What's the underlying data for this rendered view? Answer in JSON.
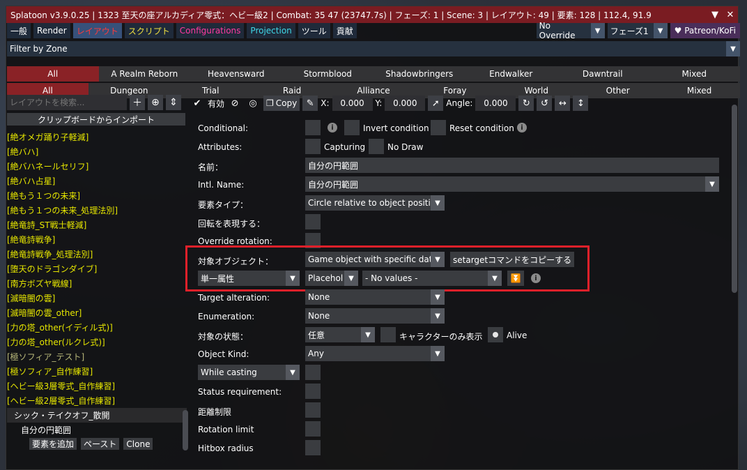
{
  "window": {
    "title": "Splatoon v3.9.0.25 | 1323 至天の座アルカディア零式：ヘビー級2 | Combat: 35 47 (23747.7s) | フェーズ: 1 | Scene: 3 | レイアウト: 49 | 要素: 128 | 112.4, 91.9",
    "collapse_glyph": "▼",
    "close_glyph": "✕"
  },
  "menu": {
    "tabs": [
      {
        "label": "一般",
        "color": "#ffffff"
      },
      {
        "label": "Render",
        "color": "#ffffff"
      },
      {
        "label": "レイアウト",
        "color": "#ff3a3a"
      },
      {
        "label": "スクリプト",
        "color": "#f0e040"
      },
      {
        "label": "Configurations",
        "color": "#ff3aa0"
      },
      {
        "label": "Projection",
        "color": "#40d8e8"
      },
      {
        "label": "ツール",
        "color": "#ffffff"
      },
      {
        "label": "貢献",
        "color": "#ffffff"
      }
    ],
    "override_select": "No Override",
    "phase_select": "フェーズ1",
    "patreon": "♥ Patreon/KoFi"
  },
  "filter": {
    "label": "Filter by Zone"
  },
  "zones_row1": [
    "All",
    "A Realm Reborn",
    "Heavensward",
    "Stormblood",
    "Shadowbringers",
    "Endwalker",
    "Dawntrail",
    "Mixed"
  ],
  "zones_row2": [
    "All",
    "Dungeon",
    "Trial",
    "Raid",
    "Alliance",
    "Foray",
    "World",
    "Other",
    "Mixed"
  ],
  "left": {
    "search_placeholder": "レイアウトを検索...",
    "import_label": "クリップボードからインポート",
    "layouts": [
      "[絶オメガ踊り子軽減]",
      "[絶バハ]",
      "[絶バハネールセリフ]",
      "[絶バハ占星]",
      "[絶もう１つの未来]",
      "[絶もう１つの未来_処理法別]",
      "[絶竜詩_ST戦士軽減]",
      "[絶竜詩戦争]",
      "[絶竜詩戦争_処理法別]",
      "[堕天のドラゴンダイブ]",
      "[南方ボズヤ戦線]",
      "[滅暗闇の雲]",
      "[滅暗闇の雲_other]",
      "[力の塔_other(イディル式)]",
      "[力の塔_other(ルクレ式)]",
      "[極ソフィア_テスト]",
      "[極ソフィア_自作練習]",
      "[ヘビー級3層零式_自作練習]",
      "[ヘビー級2層零式_自作練習]"
    ],
    "selected_layout": "シック・テイクオフ_散開",
    "selected_element": "自分の円範囲",
    "add_element": "要素を追加",
    "paste": "ペースト",
    "clone": "Clone"
  },
  "toolbar": {
    "enabled_label": "有効",
    "copy_label": "Copy",
    "x_label": "X:",
    "x_value": "0.000",
    "y_label": "Y:",
    "y_value": "0.000",
    "angle_label": "Angle:",
    "angle_value": "0.000"
  },
  "props": {
    "conditional": "Conditional:",
    "invert_condition": "Invert condition",
    "reset_condition": "Reset condition",
    "attributes": "Attributes:",
    "capturing": "Capturing",
    "no_draw": "No Draw",
    "name_label": "名前：",
    "name_value": "自分の円範囲",
    "intl_name_label": "Intl. Name:",
    "intl_name_value": "自分の円範囲",
    "element_type_label": "要素タイプ：",
    "element_type_value": "Circle relative to object positio",
    "rotation_label": "回転を表現する：",
    "override_rotation_label": "Override rotation:",
    "target_object_label": "対象オブジェクト：",
    "target_object_value": "Game object with specific data",
    "setarget_copy": "setargetコマンドをコピーする",
    "single_attr": "単一属性",
    "placeholder_value": "Placehol",
    "no_values": "- No values -",
    "target_alteration_label": "Target alteration:",
    "target_alteration_value": "None",
    "enumeration_label": "Enumeration:",
    "enumeration_value": "None",
    "target_state_label": "対象の状態：",
    "target_state_value": "任意",
    "character_only": "キャラクターのみ表示",
    "alive": "Alive",
    "object_kind_label": "Object Kind:",
    "object_kind_value": "Any",
    "while_casting": "While casting",
    "status_requirement": "Status requirement:",
    "distance_limit": "距離制限",
    "rotation_limit": "Rotation limit",
    "hitbox_radius": "Hitbox radius"
  }
}
